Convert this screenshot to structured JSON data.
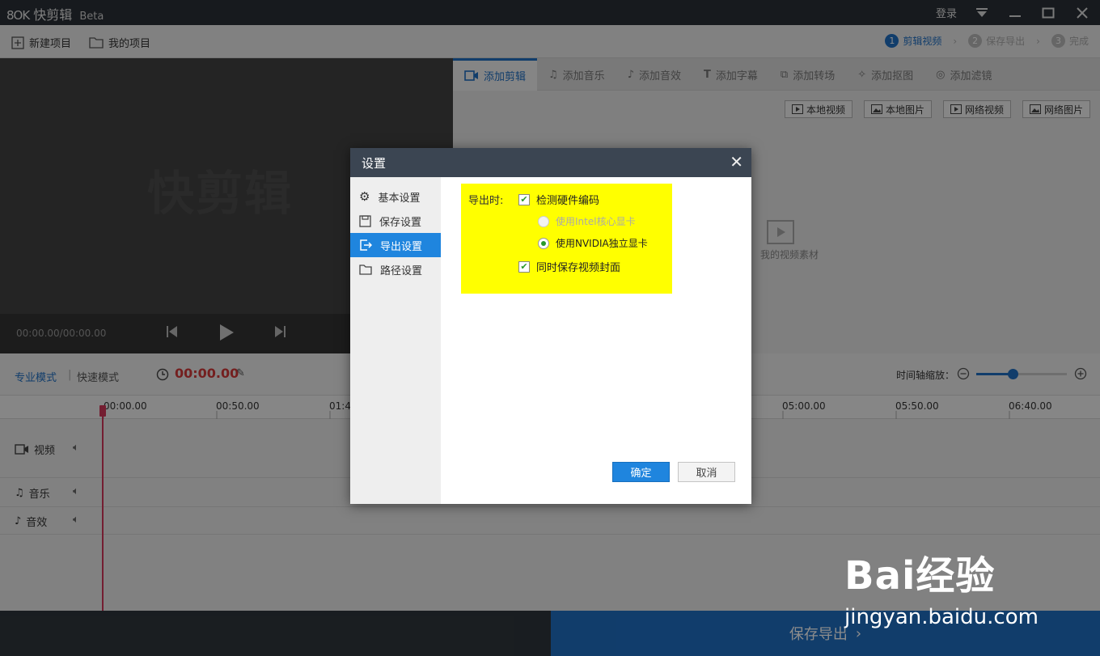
{
  "app": {
    "logo": "8OK",
    "name": "快剪辑",
    "edition": "Beta"
  },
  "window": {
    "login": "登录"
  },
  "toolbar": {
    "new_project": "新建项目",
    "my_projects": "我的项目",
    "steps": [
      {
        "num": "1",
        "label": "剪辑视频",
        "active": true
      },
      {
        "num": "2",
        "label": "保存导出",
        "active": false
      },
      {
        "num": "3",
        "label": "完成",
        "active": false
      }
    ]
  },
  "preview": {
    "watermark": "快剪辑",
    "time": "00:00.00/00:00.00"
  },
  "tabs": [
    "添加剪辑",
    "添加音乐",
    "添加音效",
    "添加字幕",
    "添加转场",
    "添加抠图",
    "添加滤镜"
  ],
  "sources": [
    "本地视频",
    "本地图片",
    "网络视频",
    "网络图片"
  ],
  "material_hint": "我的视频素材",
  "timeline": {
    "mode_pro": "专业模式",
    "mode_fast": "快速模式",
    "current_time": "00:00.00",
    "zoom_label": "时间轴缩放：",
    "zoom_level": 0.4,
    "ticks": [
      "00:00.00",
      "00:50.00",
      "01:4",
      "05:00.00",
      "05:50.00",
      "06:40.00"
    ],
    "tracks": [
      "视频",
      "音乐",
      "音效"
    ]
  },
  "bottom": {
    "export": "保存导出"
  },
  "dialog": {
    "title": "设置",
    "sidebar": [
      "基本设置",
      "保存设置",
      "导出设置",
      "路径设置"
    ],
    "active_index": 2,
    "export_label": "导出时:",
    "options": {
      "detect_hw": "检测硬件编码",
      "intel": "使用Intel核心显卡",
      "nvidia": "使用NVIDIA独立显卡",
      "save_cover": "同时保存视频封面"
    },
    "ok": "确定",
    "cancel": "取消"
  },
  "watermark": {
    "brand": "Bai经验",
    "url": "jingyan.baidu.com"
  }
}
